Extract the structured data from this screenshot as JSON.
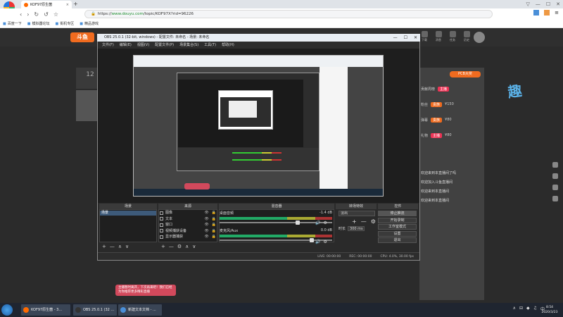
{
  "browser": {
    "logo_text": "Click here",
    "tab_title": "KOF97原生菌",
    "tab_close": "×",
    "new_tab": "+",
    "window_controls": [
      "▽",
      "—",
      "☐",
      "✕"
    ],
    "nav_icons": [
      "‹",
      "›",
      "↻",
      "↺",
      "☆"
    ],
    "url_scheme": "https://",
    "url_host": "www.douyu.com",
    "url_path": "/topic/KOF97X?rid=96226",
    "bookmarks": [
      "百度一下",
      "模拟器论坛",
      "街机专区",
      "精品游戏"
    ]
  },
  "douyu": {
    "logo": "斗鱼",
    "header_icons": [
      "下载",
      "消息",
      "任务",
      "历史"
    ],
    "left_count": "12",
    "pcb_badge": "PCB大奖",
    "rank_rows": [
      {
        "label": "贡献周榜",
        "pill": "主播",
        "amount": "",
        "cls": "pill"
      },
      {
        "label": "粉丝",
        "pill": "贵族",
        "amount": "¥150",
        "cls": "pill o"
      },
      {
        "label": "弹幕",
        "pill": "贵族",
        "amount": "¥80",
        "cls": "pill o"
      },
      {
        "label": "礼物",
        "pill": "主播",
        "amount": "¥80",
        "cls": "pill"
      }
    ],
    "chat_lines": [
      "欢迎来到本直播间了吗",
      "欢迎加入斗鱼直播间",
      "欢迎来到本直播间",
      "欢迎来到本直播间"
    ],
    "deco_text": "趣",
    "toast_text": "主播暂时离开，下次再来吧！我们已经为你推荐更多精彩直播"
  },
  "obs": {
    "title": "OBS 25.0.1 (32-bit, windows) - 配置文件: 未命名 - 场景: 未命名",
    "title_controls": [
      "—",
      "☐",
      "✕"
    ],
    "menu": [
      "文件(F)",
      "编辑(E)",
      "视图(V)",
      "配置文件(P)",
      "场景集合(S)",
      "工具(T)",
      "帮助(H)"
    ],
    "docks": {
      "scenes_label": "场景",
      "sources_label": "来源",
      "mixer_label": "混音器",
      "transitions_label": "转场特效",
      "controls_label": "控件"
    },
    "scene_name": "场景",
    "sources": [
      "图像",
      "文本",
      "窗口",
      "视频捕获设备",
      "显示器捕获"
    ],
    "footer_buttons": [
      "+",
      "—",
      "∧",
      "∨"
    ],
    "source_footer": [
      "+",
      "—",
      "⚙",
      "∧",
      "∨"
    ],
    "mixer": [
      {
        "name": "桌面音频",
        "db": "-1.4 dB"
      },
      {
        "name": "麦克风/Aux",
        "db": "0.0 dB"
      }
    ],
    "transition_select": "淡出",
    "duration_label": "时长",
    "duration_value": "300 ms",
    "controls": [
      "停止推流",
      "开始录制",
      "工作室模式",
      "设置",
      "退出"
    ],
    "status": {
      "live": "LIVE: 00:00:00",
      "rec": "REC: 00:00:00",
      "cpu": "CPU: 4.0%, 30.00 fps"
    }
  },
  "taskbar": {
    "tasks": [
      {
        "label": "KOF97原生菌 - 3...",
        "color": "#ff6a00"
      },
      {
        "label": "OBS 25.0.1 (32 ...",
        "color": "#333"
      },
      {
        "label": "新建文本文档 - ...",
        "color": "#4a8fd8"
      }
    ],
    "tray": [
      "∧",
      "⊟",
      "◆",
      "♫",
      "中"
    ],
    "time": "8:54",
    "date": "2020/3/23"
  }
}
